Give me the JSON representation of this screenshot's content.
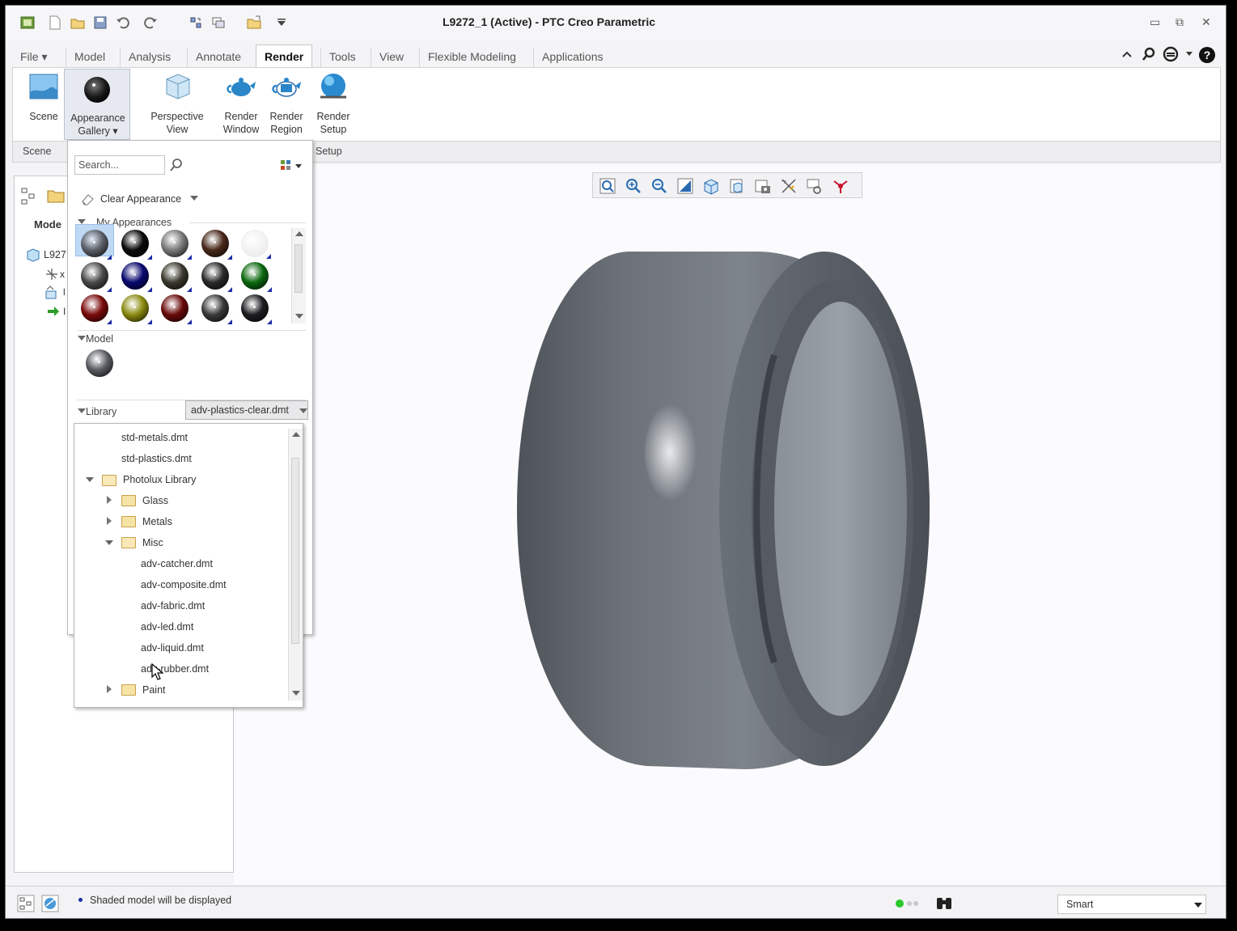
{
  "window": {
    "title": "L9272_1 (Active) - PTC Creo Parametric",
    "controls": [
      "minimize",
      "restore",
      "close"
    ]
  },
  "quick_access": [
    "app-icon",
    "new-icon",
    "open-icon",
    "save-icon",
    "undo-icon",
    "redo-icon",
    "regenerate-icon",
    "windows-icon",
    "close-window-icon",
    "customize-icon"
  ],
  "tabs": [
    {
      "label": "File ▾",
      "active": false
    },
    {
      "label": "Model",
      "active": false
    },
    {
      "label": "Analysis",
      "active": false
    },
    {
      "label": "Annotate",
      "active": false
    },
    {
      "label": "Render",
      "active": true
    },
    {
      "label": "Tools",
      "active": false
    },
    {
      "label": "View",
      "active": false
    },
    {
      "label": "Flexible Modeling",
      "active": false
    },
    {
      "label": "Applications",
      "active": false
    }
  ],
  "ribbon": {
    "scene": "Scene",
    "appearance_gallery_1": "Appearance",
    "appearance_gallery_2": "Gallery ▾",
    "perspective_1": "Perspective",
    "perspective_2": "View",
    "render_window_1": "Render",
    "render_window_2": "Window",
    "render_region_1": "Render",
    "render_region_2": "Region",
    "render_setup_1": "Render",
    "render_setup_2": "Setup"
  },
  "groups": {
    "scene": "Scene",
    "setup": "Setup"
  },
  "left_panel": {
    "tab_label": "Mode",
    "tree_root": "L927",
    "tree_item_1": "x l",
    "tree_item_2": "l",
    "tree_item_3": "I"
  },
  "gallery": {
    "search_placeholder": "Search...",
    "clear_appearance": "Clear Appearance",
    "my_appearances": "My Appearances",
    "model": "Model",
    "library": "Library",
    "library_selected": "adv-plastics-clear.dmt",
    "swatches": [
      "#5c6068",
      "#0a0a0a",
      "#7a7a7a",
      "#4a2a1c",
      "#f6f6f6",
      "#4a4a4a",
      "#08086e",
      "#3a3a2e",
      "#2a2a2a",
      "#0c6a10",
      "#7a0a0a",
      "#8a8a10",
      "#6a0a0a",
      "#3a3a3a",
      "#1e1e22"
    ],
    "model_swatch": "#5a5c62"
  },
  "library_tree": {
    "std_metals": "std-metals.dmt",
    "std_plastics": "std-plastics.dmt",
    "photolux": "Photolux Library",
    "glass": "Glass",
    "metals": "Metals",
    "misc": "Misc",
    "adv_catcher": "adv-catcher.dmt",
    "adv_composite": "adv-composite.dmt",
    "adv_fabric": "adv-fabric.dmt",
    "adv_led": "adv-led.dmt",
    "adv_liquid": "adv-liquid.dmt",
    "adv_rubber": "adv-rubber.dmt",
    "paint": "Paint"
  },
  "statusbar": {
    "message": "Shaded model will be displayed",
    "filter": "Smart"
  },
  "colors": {
    "tire": "#6a7078",
    "accent": "#1d2fa8"
  }
}
